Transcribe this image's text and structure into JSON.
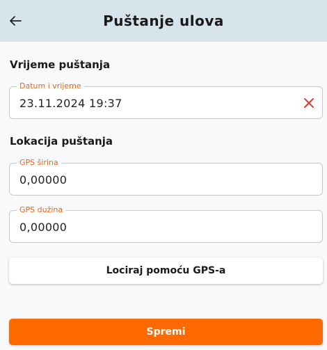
{
  "header": {
    "title": "Puštanje ulova",
    "back_icon": "arrow-left-icon"
  },
  "release_time": {
    "section_title": "Vrijeme puštanja",
    "datetime_label": "Datum i vrijeme",
    "datetime_value": "23.11.2024 19:37",
    "clear_icon": "close-icon"
  },
  "release_location": {
    "section_title": "Lokacija puštanja",
    "latitude_label": "GPS širina",
    "latitude_value": "0,00000",
    "longitude_label": "GPS dužina",
    "longitude_value": "0,00000"
  },
  "actions": {
    "locate_label": "Lociraj pomoću GPS-a",
    "save_label": "Spremi"
  },
  "colors": {
    "header_bg": "#d7e4ec",
    "accent_orange": "#ff6a00",
    "label_orange": "#e8651e",
    "clear_red": "#e53935"
  }
}
